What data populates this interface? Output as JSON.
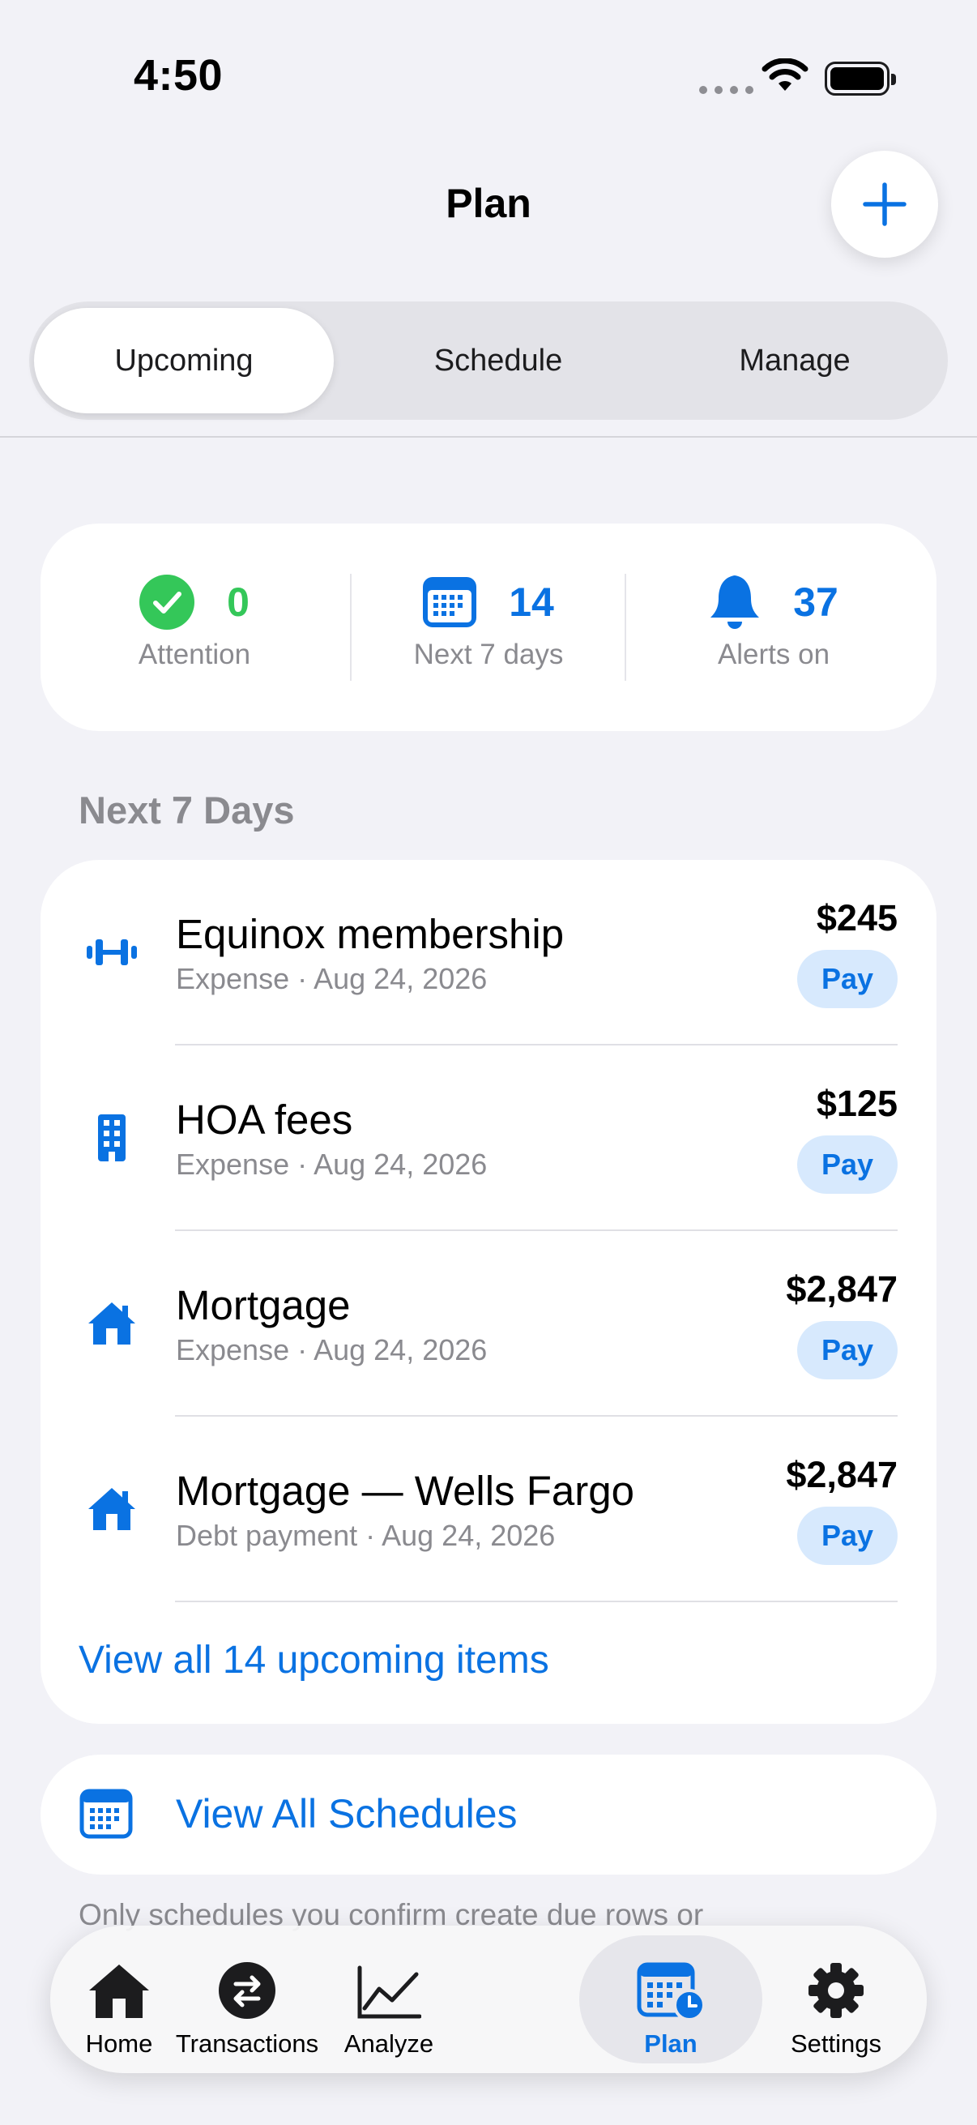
{
  "status_bar": {
    "time": "4:50"
  },
  "header": {
    "title": "Plan"
  },
  "segments": [
    {
      "label": "Upcoming",
      "active": true
    },
    {
      "label": "Schedule",
      "active": false
    },
    {
      "label": "Manage",
      "active": false
    }
  ],
  "summary": {
    "attention": {
      "value": "0",
      "label": "Attention",
      "color": "#34C759"
    },
    "next_days": {
      "value": "14",
      "label": "Next 7 days",
      "color": "#0A72E2"
    },
    "alerts": {
      "value": "37",
      "label": "Alerts on",
      "color": "#0A72E2"
    }
  },
  "section_title": "Next 7 Days",
  "items": [
    {
      "name": "Equinox membership",
      "subtitle": "Expense · Aug 24, 2026",
      "amount": "$245",
      "action": "Pay",
      "icon": "dumbbell-icon"
    },
    {
      "name": "HOA fees",
      "subtitle": "Expense · Aug 24, 2026",
      "amount": "$125",
      "action": "Pay",
      "icon": "building-icon"
    },
    {
      "name": "Mortgage",
      "subtitle": "Expense · Aug 24, 2026",
      "amount": "$2,847",
      "action": "Pay",
      "icon": "house-icon"
    },
    {
      "name": "Mortgage — Wells Fargo",
      "subtitle": "Debt payment · Aug 24, 2026",
      "amount": "$2,847",
      "action": "Pay",
      "icon": "house-icon"
    }
  ],
  "view_all_link": "View all 14 upcoming items",
  "view_all_schedules": "View All Schedules",
  "footnote": "Only schedules you confirm create due rows or",
  "tabs": [
    {
      "label": "Home",
      "icon": "house-icon"
    },
    {
      "label": "Transactions",
      "icon": "arrows-exchange-icon"
    },
    {
      "label": "Analyze",
      "icon": "chart-line-icon"
    },
    {
      "label": "Plan",
      "icon": "calendar-clock-icon",
      "active": true
    },
    {
      "label": "Settings",
      "icon": "gear-icon"
    }
  ],
  "colors": {
    "accent": "#0A72E2",
    "success": "#34C759",
    "background": "#F2F2F7",
    "pay_button_bg": "#D7E9FD"
  }
}
